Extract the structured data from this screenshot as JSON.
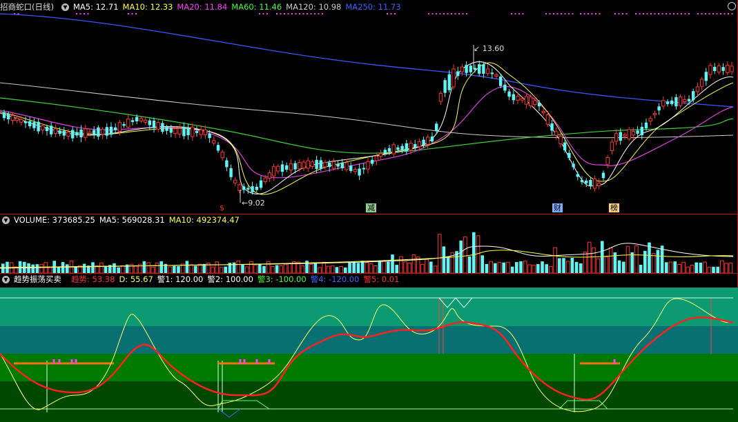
{
  "main_header": {
    "title": "招商蛇口(日线)",
    "ma": [
      {
        "label": "MA5: 12.71",
        "color": "#ffffff"
      },
      {
        "label": "MA10: 12.33",
        "color": "#ffff40"
      },
      {
        "label": "MA20: 11.84",
        "color": "#ff40ff"
      },
      {
        "label": "MA60: 11.46",
        "color": "#40ff40"
      },
      {
        "label": "MA120: 10.98",
        "color": "#cccccc"
      },
      {
        "label": "MA250: 11.73",
        "color": "#4060ff"
      }
    ]
  },
  "price_annotations": {
    "high": "13.60",
    "low": "9.02"
  },
  "event_tags": [
    {
      "label": "$",
      "color": "#ff3030",
      "bg": "transparent"
    },
    {
      "label": "减",
      "color": "#000000",
      "bg": "#90d090"
    },
    {
      "label": "财",
      "color": "#000000",
      "bg": "#80b0ff"
    },
    {
      "label": "榜",
      "color": "#000000",
      "bg": "#ffd080"
    }
  ],
  "volume_header": {
    "label": "VOLUME: 373685.25",
    "ma5": "MA5: 569028.31",
    "ma10": "MA10: 492374.47"
  },
  "indicator_header": {
    "title": "趋势振荡买卖",
    "values": [
      {
        "label": "趋势: 53.38",
        "color": "#ff3030"
      },
      {
        "label": "D: 55.67",
        "color": "#ffff60"
      },
      {
        "label": "警1: 120.00",
        "color": "#ffffff"
      },
      {
        "label": "警2: 100.00",
        "color": "#ffffff"
      },
      {
        "label": "警3: -100.00",
        "color": "#40ff40"
      },
      {
        "label": "警4: -120.00",
        "color": "#4060ff"
      },
      {
        "label": "警5: 0.01",
        "color": "#ff3030"
      }
    ]
  },
  "colors": {
    "up": "#ff3333",
    "down": "#5ff5f5",
    "zone_top": "#0b9a72",
    "zone_mid": "#087070",
    "zone_low1": "#007a00",
    "zone_low2": "#004800",
    "trend": "#ff2020",
    "d_line": "#ffff66"
  }
}
